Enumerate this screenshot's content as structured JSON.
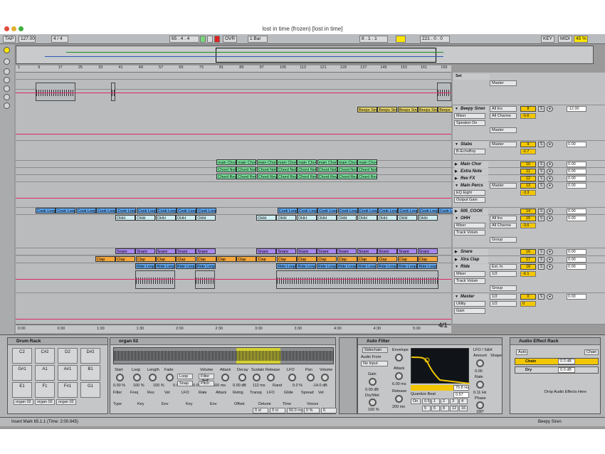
{
  "window": {
    "title": "lost in time (frozen)  [lost in time]"
  },
  "control": {
    "tap": "TAP",
    "tempo": "127.00",
    "meter": "4 / 4",
    "pos": "65 .  4 .  4",
    "ovr": "OVR",
    "quant": "1 Bar",
    "loop_start": "8 .  1 .  1",
    "loop_len": "221 .  0 .  0",
    "key": "KEY",
    "midi": "MIDI",
    "cpu": "45 %"
  },
  "ruler": [
    "1",
    "9",
    "17",
    "25",
    "33",
    "41",
    "49",
    "57",
    "65",
    "73",
    "81",
    "89",
    "97",
    "105",
    "113",
    "121",
    "129",
    "137",
    "145",
    "153",
    "161",
    "169"
  ],
  "timeline": [
    "0:00",
    "0:30",
    "1:00",
    "1:30",
    "2:00",
    "2:30",
    "3:00",
    "3:30",
    "4:00",
    "4:30",
    "5:00"
  ],
  "set_label": "Set",
  "beepy_clip": "Beeps Sin",
  "stabs_clips": [
    {
      "label": "main Chor",
      "color": "#7ee8a2"
    },
    {
      "label": "Chord Not",
      "color": "#7ee8a2"
    },
    {
      "label": "Chord Rev",
      "color": "#7ee8a2"
    }
  ],
  "cook_clip": "Cook Loop",
  "ohh_clip": "OHH",
  "snare_clip": "Snare",
  "clap_clip": "Clap",
  "ride_clip": "Ride Loop",
  "tracks": [
    {
      "name": "",
      "num": "",
      "in": "Master",
      "sel": "",
      "mon": ""
    },
    {
      "name": "Beepy Siren",
      "num": "8",
      "in": "All Ins",
      "sel": "Mixer",
      "mon": "Speaker On",
      "extra": "All Channe",
      "out": "Master",
      "vol": "-0.6",
      "val": "-12.00",
      "open": true
    },
    {
      "name": "Stabs",
      "num": "9",
      "in": "Master",
      "sel": "B-EchoBoy",
      "vol": "-2.7",
      "val": "0.00",
      "open": true
    },
    {
      "name": "Main Chor",
      "num": "10",
      "val": "0.00"
    },
    {
      "name": "Extra Note",
      "num": "11",
      "val": "0.00"
    },
    {
      "name": "Rev FX",
      "num": "12",
      "val": "0.00"
    },
    {
      "name": "Main Percs",
      "num": "13",
      "in": "Master",
      "sel": "EQ Eight",
      "mon": "Output Gain",
      "vol": "-3.3",
      "val": "0.00",
      "open": true
    },
    {
      "name": "505_COOK",
      "num": "14",
      "val": "0.00"
    },
    {
      "name": "OHH",
      "num": "15",
      "in": "All Ins",
      "sel": "Mixer",
      "mon": "Track Volum",
      "extra": "All Channe",
      "out": "Group",
      "vol": "-3.6",
      "val": "0.00",
      "open": true
    },
    {
      "name": "Snare",
      "num": "16",
      "val": "0.00"
    },
    {
      "name": "Xtra Clap",
      "num": "17",
      "val": "0.00"
    },
    {
      "name": "Ride",
      "num": "18",
      "in": "Ext. In",
      "sel": "Mixer",
      "mon": "Track Volum",
      "extra": "1/2",
      "out": "Group",
      "vol": "-6.1",
      "val": "0.00",
      "open": true
    },
    {
      "name": "Master",
      "num": "0",
      "in": "1/2",
      "sel": "Utility",
      "mon": "Gain",
      "extra": "1/2",
      "vol": "0",
      "val": "0.00",
      "open": true
    }
  ],
  "drum_rack": {
    "title": "Drum Rack",
    "pads": [
      "C2",
      "C#2",
      "D2",
      "D#2",
      "G#1",
      "A1",
      "A#1",
      "B1",
      "E1",
      "F1",
      "F#1",
      "G1"
    ],
    "slots": [
      "organ 02",
      "organ 02",
      "organ 02"
    ]
  },
  "simpler": {
    "title": "organ 02",
    "labels": [
      "Start",
      "Loop",
      "Length",
      "Fade",
      "Volume",
      "Attack",
      "Decay",
      "Sustain",
      "Release",
      "LFO",
      "Pan",
      "Volume"
    ],
    "vals": [
      "0.00 %",
      "100 %",
      "100 %",
      "0.00 %",
      "0.00 ms",
      "600 ms",
      "0.00 dB",
      "112 ms",
      "Rand",
      "0.0 %",
      "-14.0 dB"
    ],
    "btns": [
      "Loop",
      "Snap",
      "Filter",
      "Pitch"
    ],
    "labels2": [
      "Filter",
      "Freq",
      "Res",
      "Vel",
      "LFO",
      "Rate",
      "Attack",
      "Retrig",
      "Transp",
      "LFO",
      "Glide",
      "Spread",
      "Vel"
    ],
    "vals2": [
      "Type",
      "Key",
      "Env",
      "Key",
      "Env",
      "Offset",
      "Detune",
      "Time",
      "Voices"
    ],
    "vals3": [
      "0 st",
      "0 ct",
      "50.0 ms",
      "0 %",
      "6"
    ]
  },
  "autofilter": {
    "title": "Auto Filter",
    "sidechain": "Sidechain",
    "audio_from": "Audio From",
    "no_input": "No Input",
    "gain": "Gain",
    "gain_val": "0.00 dB",
    "drywet": "Dry/Wet",
    "dw_val": "100 %",
    "env": "Envelope",
    "attack": "Attack",
    "att_val": "6.00 ms",
    "release": "Release",
    "rel_val": "200 ms",
    "quant": "Quantize Beat",
    "on": "On",
    "beats": [
      "0.5",
      "1",
      "2",
      "3",
      "4",
      "5",
      "6",
      "8",
      "12",
      "16"
    ],
    "freq": "75.8 Hz",
    "q": "0.57",
    "lfo": "LFO / S&H",
    "amount": "Amount",
    "amt_val": "0.00",
    "rate": "Rate",
    "rate_val": "0.11 Hz",
    "phase": "Phase",
    "phase_val": "180°",
    "shape": "Shape"
  },
  "rack": {
    "title": "Audio Effect Rack",
    "auto": "Auto",
    "chain": "Chain",
    "chain_val": "0.0 dB",
    "dry": "Dry",
    "dry_val": "0.0 dB",
    "drop": "Drop Audio Effects Here"
  },
  "status": {
    "left": "Insert Mark 65.1.1 (Time: 2:00.945)",
    "right": "Beepy Siren"
  },
  "colors": {
    "clip_blue": "#62a8f0",
    "clip_green": "#7ee8a2",
    "clip_orange": "#f7a83a",
    "clip_purple": "#a888f0",
    "clip_yellow": "#e9d86a",
    "clip_cyan": "#cfeef4",
    "auto": "#e0286a"
  }
}
